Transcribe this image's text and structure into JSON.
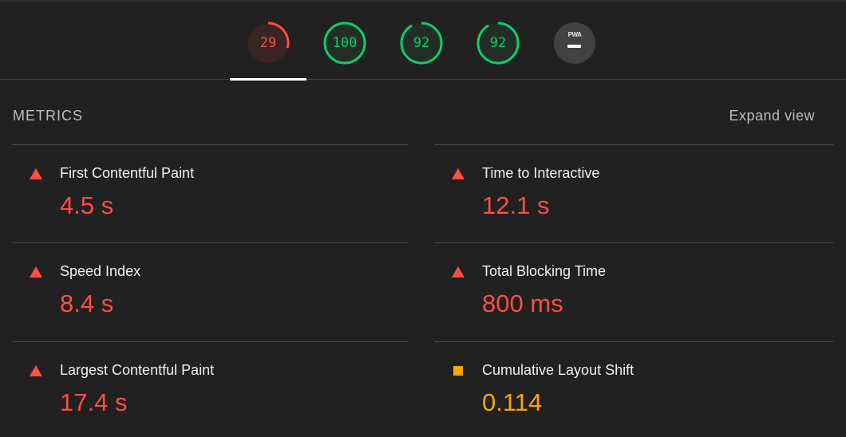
{
  "colors": {
    "fail": "#ff4e42",
    "average": "#ffa400",
    "pass": "#0cce6b",
    "background": "#212121"
  },
  "gauges": [
    {
      "name": "performance",
      "value": "29",
      "score": 0.29,
      "status": "fail"
    },
    {
      "name": "accessibility",
      "value": "100",
      "score": 1.0,
      "status": "pass"
    },
    {
      "name": "best-practices",
      "value": "92",
      "score": 0.92,
      "status": "pass"
    },
    {
      "name": "seo",
      "value": "92",
      "score": 0.92,
      "status": "pass"
    },
    {
      "name": "pwa",
      "badge_text": "PWA",
      "icon": "pwa-badge-icon"
    }
  ],
  "metrics": {
    "title": "METRICS",
    "expand_label": "Expand view",
    "items": [
      {
        "label": "First Contentful Paint",
        "value": "4.5 s",
        "status": "fail",
        "icon": "triangle-icon"
      },
      {
        "label": "Time to Interactive",
        "value": "12.1 s",
        "status": "fail",
        "icon": "triangle-icon"
      },
      {
        "label": "Speed Index",
        "value": "8.4 s",
        "status": "fail",
        "icon": "triangle-icon"
      },
      {
        "label": "Total Blocking Time",
        "value": "800 ms",
        "status": "fail",
        "icon": "triangle-icon"
      },
      {
        "label": "Largest Contentful Paint",
        "value": "17.4 s",
        "status": "fail",
        "icon": "triangle-icon"
      },
      {
        "label": "Cumulative Layout Shift",
        "value": "0.114",
        "status": "average",
        "icon": "square-icon"
      }
    ]
  }
}
